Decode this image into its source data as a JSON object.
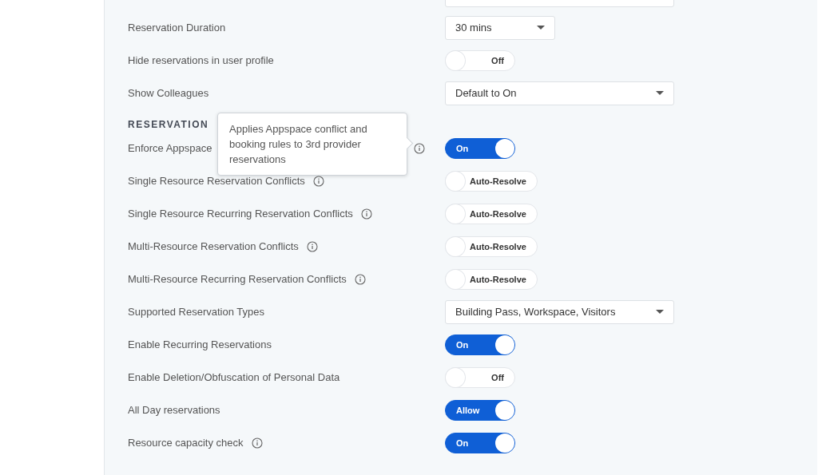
{
  "rows": [
    {
      "kind": "field",
      "label": ""
    },
    {
      "kind": "select",
      "label": "Reservation Duration",
      "value": "30 mins",
      "compact": true
    },
    {
      "kind": "toggle",
      "label": "Hide reservations in user profile",
      "on": false,
      "state_text": "Off"
    },
    {
      "kind": "select",
      "label": "Show Colleagues",
      "value": "Default to On",
      "compact": false
    },
    {
      "kind": "heading",
      "label": "RESERVATION"
    },
    {
      "kind": "toggle",
      "label": "Enforce Appspace",
      "info": true,
      "on": true,
      "state_text": "On",
      "tooltip": "Applies Appspace conflict and booking rules to 3rd provider reservations"
    },
    {
      "kind": "toggle",
      "label": "Single Resource Reservation Conflicts",
      "info": true,
      "on": false,
      "state_text": "Auto-Resolve"
    },
    {
      "kind": "toggle",
      "label": "Single Resource Recurring Reservation Conflicts",
      "info": true,
      "on": false,
      "state_text": "Auto-Resolve"
    },
    {
      "kind": "toggle",
      "label": "Multi-Resource Reservation Conflicts",
      "info": true,
      "on": false,
      "state_text": "Auto-Resolve"
    },
    {
      "kind": "toggle",
      "label": "Multi-Resource Recurring Reservation Conflicts",
      "info": true,
      "on": false,
      "state_text": "Auto-Resolve"
    },
    {
      "kind": "select",
      "label": "Supported Reservation Types",
      "value": "Building Pass, Workspace, Visitors",
      "compact": false
    },
    {
      "kind": "toggle",
      "label": "Enable Recurring Reservations",
      "on": true,
      "state_text": "On"
    },
    {
      "kind": "toggle",
      "label": "Enable Deletion/Obfuscation of Personal Data",
      "on": false,
      "state_text": "Off"
    },
    {
      "kind": "toggle",
      "label": "All Day reservations",
      "on": true,
      "state_text": "Allow"
    },
    {
      "kind": "toggle",
      "label": "Resource capacity check",
      "info": true,
      "on": true,
      "state_text": "On"
    }
  ]
}
